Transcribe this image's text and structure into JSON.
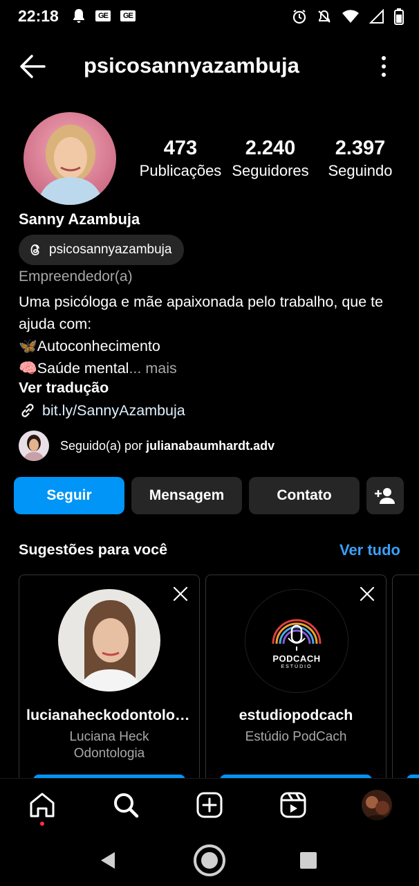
{
  "status_bar": {
    "time": "22:18",
    "left_icons": [
      "bell-icon",
      "ge-badge",
      "ge-badge"
    ],
    "ge_label": "GE",
    "right_icons": [
      "alarm-icon",
      "mute-icon",
      "wifi-icon",
      "signal-icon",
      "battery-icon"
    ]
  },
  "header": {
    "username": "psicosannyazambuja"
  },
  "profile": {
    "stats": [
      {
        "value": "473",
        "label": "Publicações"
      },
      {
        "value": "2.240",
        "label": "Seguidores"
      },
      {
        "value": "2.397",
        "label": "Seguindo"
      }
    ],
    "full_name": "Sanny Azambuja",
    "threads_handle": "psicosannyazambuja",
    "category": "Empreendedor(a)",
    "bio_line1": "Uma psicóloga e mãe apaixonada pelo trabalho, que te ajuda com:",
    "bio_line2": "🦋Autoconhecimento",
    "bio_line3": "🧠Saúde mental",
    "bio_more": "... mais",
    "translate": "Ver tradução",
    "link": "bit.ly/SannyAzambuja",
    "followed_prefix": "Seguido(a) por ",
    "followed_by": "julianabaumhardt.adv"
  },
  "actions": {
    "follow": "Seguir",
    "message": "Mensagem",
    "contact": "Contato"
  },
  "suggestions": {
    "title": "Sugestões para você",
    "see_all": "Ver tudo",
    "cards": [
      {
        "username": "lucianaheckodontologia",
        "name": "Luciana Heck Odontologia"
      },
      {
        "username": "estudiopodcach",
        "name": "Estúdio PodCach",
        "logo_text": "PODCACH",
        "logo_sub": "ESTÚDIO"
      }
    ]
  },
  "colors": {
    "accent": "#0095f6",
    "link_blue": "#3aa0f7",
    "secondary_button": "#262626",
    "muted_text": "#a8a8a8",
    "notification_dot": "#ff3040"
  },
  "bottom_nav": [
    "home-icon",
    "search-icon",
    "create-icon",
    "reels-icon",
    "profile-avatar"
  ]
}
